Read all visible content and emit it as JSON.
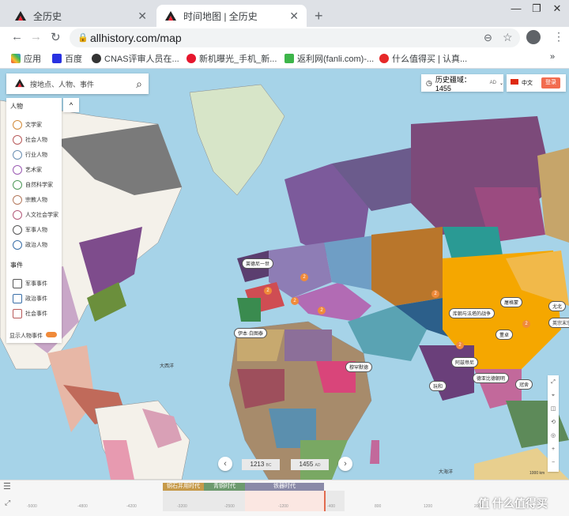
{
  "browser": {
    "tabs": [
      {
        "title": "全历史",
        "active": false
      },
      {
        "title": "时间地图 | 全历史",
        "active": true
      }
    ],
    "new_tab": "+",
    "window": {
      "minimize": "—",
      "restore": "❐",
      "close": "✕"
    },
    "url": "allhistory.com/map",
    "bookmarks": [
      {
        "label": "应用",
        "color": "#e8453c"
      },
      {
        "label": "百度",
        "color": "#2932e1"
      },
      {
        "label": "CNAS评审人员在...",
        "color": "#333333"
      },
      {
        "label": "新机曝光_手机_新...",
        "color": "#e6162d"
      },
      {
        "label": "返利网(fanli.com)-...",
        "color": "#3db54a"
      },
      {
        "label": "什么值得买 | 认真...",
        "color": "#e62828"
      }
    ],
    "bookmarks_more": "»"
  },
  "search": {
    "placeholder": "搜地点、人物、事件"
  },
  "panel": {
    "people_header": "人物",
    "people": [
      "文学家",
      "社会人物",
      "行业人物",
      "艺术家",
      "自然科学家",
      "宗教人物",
      "人文社会学家",
      "军事人物",
      "政治人物"
    ],
    "events_header": "事件",
    "events": [
      "军事事件",
      "政治事件",
      "社会事件"
    ],
    "toggle_label": "显示人物事件",
    "collapse": "^"
  },
  "era_selector": {
    "label": "历史疆域：1455",
    "suffix": "AD"
  },
  "language": {
    "label": "中文",
    "login": "登录"
  },
  "map_pins": [
    {
      "label": "莱德尼一世"
    },
    {
      "label": "伊本·白图泰"
    },
    {
      "label": "穆罕默德"
    },
    {
      "label": "库朝与法塔的战争"
    },
    {
      "label": "屠格蒙"
    },
    {
      "label": "董卓"
    },
    {
      "label": "阿兹帝尼"
    },
    {
      "label": "德亚比德朝明"
    },
    {
      "label": "玩和"
    },
    {
      "label": "冠舍"
    },
    {
      "label": "尤北"
    },
    {
      "label": "英宗末宗"
    }
  ],
  "map_labels": {
    "ocean": "大西洋",
    "ocean2": "大海洋",
    "scale": "1000 km"
  },
  "time_control": {
    "prev": "‹",
    "next": "›",
    "year_from": "1213",
    "era_from": "BC",
    "year_to": "1455",
    "era_to": "AD"
  },
  "timeline": {
    "eras": [
      "铜石并用时代",
      "青铜时代",
      "铁器时代"
    ],
    "ticks": [
      "-5000",
      "-4800",
      "-4200",
      "-3200",
      "-2500",
      "-1200",
      "-400",
      "800",
      "1200",
      "2000"
    ]
  },
  "watermark": "值  什么值得买",
  "zoom": {
    "in": "+",
    "out": "−"
  }
}
